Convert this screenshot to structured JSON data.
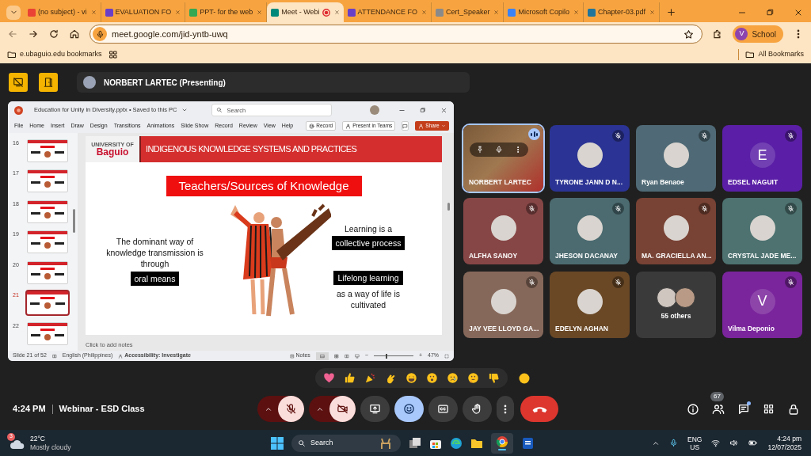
{
  "browser": {
    "tabs": [
      {
        "title": "(no subject) - vi",
        "color": "#ea4335",
        "selected": false,
        "recording": false
      },
      {
        "title": "EVALUATION FO",
        "color": "#6a3fc8",
        "selected": false,
        "recording": false
      },
      {
        "title": "PPT- for the web",
        "color": "#34a853",
        "selected": false,
        "recording": false
      },
      {
        "title": "Meet - Webi",
        "color": "#00897b",
        "selected": true,
        "recording": true
      },
      {
        "title": "ATTENDANCE FO",
        "color": "#6a3fc8",
        "selected": false,
        "recording": false
      },
      {
        "title": "Cert_Speaker",
        "color": "#8a8a8a",
        "selected": false,
        "recording": false
      },
      {
        "title": "Microsoft Copilo",
        "color": "#3b82f6",
        "selected": false,
        "recording": false
      },
      {
        "title": "Chapter-03.pdf",
        "color": "#21759b",
        "selected": false,
        "recording": false
      }
    ],
    "address": "meet.google.com/jid-yntb-uwq",
    "profile": {
      "initial": "V",
      "label": "School"
    },
    "bookmarks": [
      {
        "label": "e.ubaguio.edu bookmarks"
      }
    ],
    "all_bookmarks": "All Bookmarks"
  },
  "meet": {
    "presenter": "NORBERT LARTEC (Presenting)",
    "presentation": {
      "file_title": "Education for Unity in Diversity.pptx • Saved to this PC",
      "search_placeholder": "Search",
      "menu": [
        "File",
        "Home",
        "Insert",
        "Draw",
        "Design",
        "Transitions",
        "Animations",
        "Slide Show",
        "Record",
        "Review",
        "View",
        "Help"
      ],
      "buttons": [
        "Record",
        "Present in Teams"
      ],
      "share": "Share",
      "thumbnails": [
        {
          "number": "16",
          "selected": false
        },
        {
          "number": "17",
          "selected": false
        },
        {
          "number": "18",
          "selected": false
        },
        {
          "number": "19",
          "selected": false
        },
        {
          "number": "20",
          "selected": false
        },
        {
          "number": "21",
          "selected": true
        },
        {
          "number": "22",
          "selected": false
        }
      ],
      "slide": {
        "logo_top": "UNIVERSITY OF",
        "logo_name": "Baguio",
        "header": "INDIGENOUS KNOWLEDGE SYSTEMS AND PRACTICES",
        "title": "Teachers/Sources of Knowledge",
        "left_text": "The dominant way of knowledge transmission is through",
        "left_highlight": "oral means",
        "right_top_text": "Learning is a",
        "right_top_highlight": "collective process",
        "right_bottom_highlight": "Lifelong learning",
        "right_bottom_text": "as a way of life is cultivated"
      },
      "notes_placeholder": "Click to add notes",
      "status": {
        "slide": "Slide 21 of 52",
        "language": "English (Philippines)",
        "accessibility": "Accessibility: Investigate",
        "notes": "Notes",
        "zoom_out": "−",
        "zoom_in": "+",
        "zoom": "47%",
        "zoom_slider": {
          "level": 0.3
        }
      }
    },
    "participants": [
      {
        "name": "NORBERT LARTEC",
        "kind": "video",
        "muted": false,
        "speaking": true
      },
      {
        "name": "TYRONE JANN D N...",
        "kind": "photo",
        "color": "#2b3494",
        "muted": true,
        "speaking": false
      },
      {
        "name": "Ryan Benaoe",
        "kind": "photo",
        "color": "#4f6a76",
        "muted": true,
        "speaking": false
      },
      {
        "name": "EDSEL NAGUIT",
        "kind": "letter",
        "letter": "E",
        "color": "#5a1fa6",
        "muted": true,
        "speaking": false
      },
      {
        "name": "ALFHA SANOY",
        "kind": "photo",
        "color": "#874646",
        "muted": true,
        "speaking": false
      },
      {
        "name": "JHESON DACANAY",
        "kind": "photo",
        "color": "#4b6b70",
        "muted": true,
        "speaking": false
      },
      {
        "name": "MA. GRACIELLA AN...",
        "kind": "photo",
        "color": "#784234",
        "muted": true,
        "speaking": false
      },
      {
        "name": "CRYSTAL JADE ME...",
        "kind": "photo",
        "color": "#4d7270",
        "muted": true,
        "speaking": false
      },
      {
        "name": "JAY VEE LLOYD GA...",
        "kind": "photo",
        "color": "#86685a",
        "muted": true,
        "speaking": false
      },
      {
        "name": "EDELYN AGHAN",
        "kind": "photo",
        "color": "#6a4826",
        "muted": true,
        "speaking": false
      },
      {
        "name": "55 others",
        "kind": "group",
        "color": "#3a3a3a",
        "muted": false,
        "speaking": false
      },
      {
        "name": "Vilma Deponio",
        "kind": "letter",
        "letter": "V",
        "color": "#7a259c",
        "muted": true,
        "speaking": false
      }
    ],
    "controls": {
      "time": "4:24 PM",
      "meeting_name": "Webinar - ESD Class",
      "mic_muted": true,
      "camera_off": true,
      "reactions_open": true,
      "people_count": "67",
      "chat_unread": true
    }
  },
  "taskbar": {
    "weather_badge": "3",
    "temperature": "22°C",
    "weather": "Mostly cloudy",
    "search_label": "Search",
    "language": "ENG",
    "region": "US",
    "time": "4:24 pm",
    "date": "12/07/2025"
  }
}
